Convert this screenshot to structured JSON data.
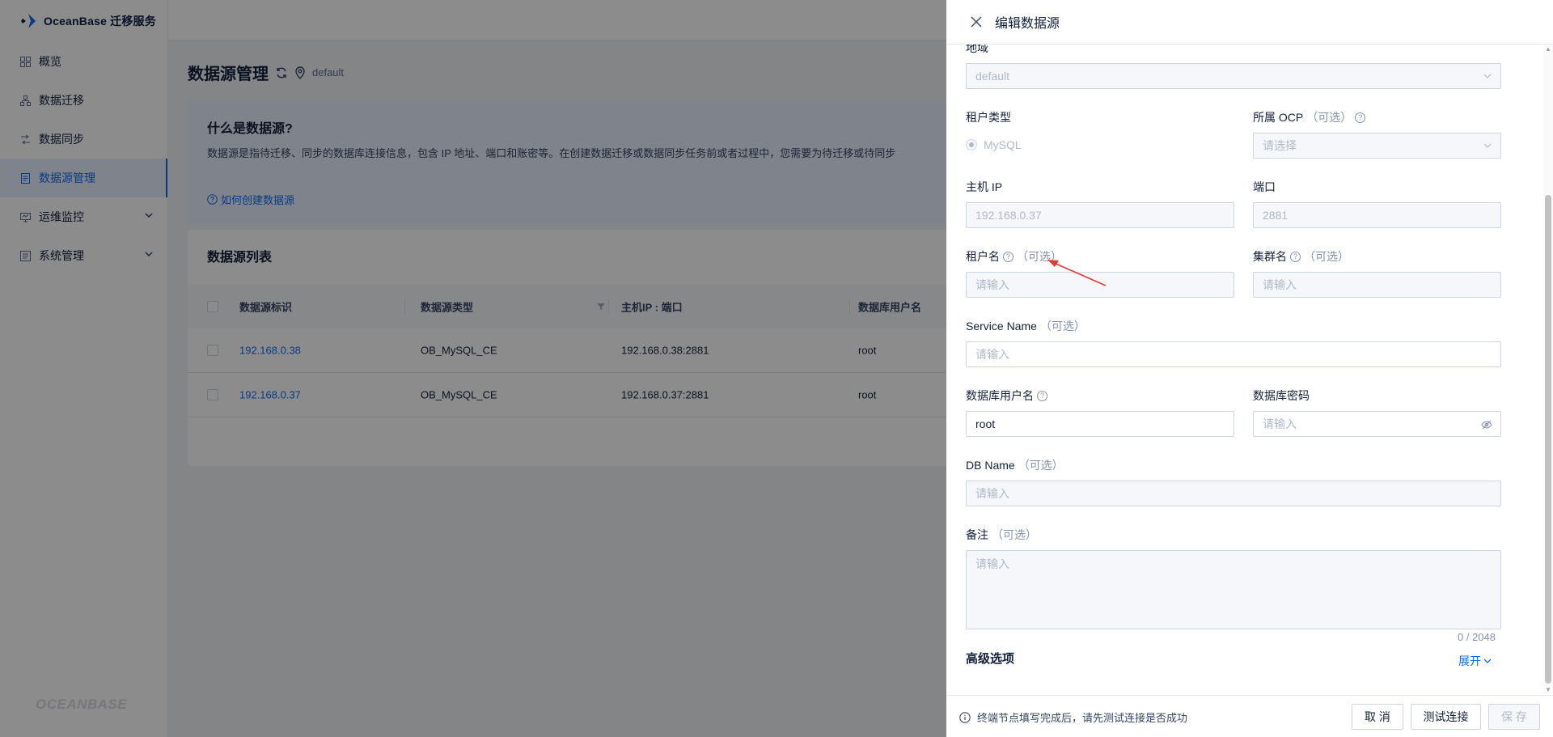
{
  "app": {
    "logo_text": "OceanBase 迁移服务",
    "footer_brand": "OCEANBASE"
  },
  "sidebar": {
    "items": [
      {
        "label": "概览",
        "icon": "grid-icon"
      },
      {
        "label": "数据迁移",
        "icon": "migrate-icon"
      },
      {
        "label": "数据同步",
        "icon": "sync-icon"
      },
      {
        "label": "数据源管理",
        "icon": "datasource-icon",
        "active": true
      },
      {
        "label": "运维监控",
        "icon": "monitor-icon",
        "expandable": true
      },
      {
        "label": "系统管理",
        "icon": "system-icon",
        "expandable": true
      }
    ]
  },
  "page": {
    "title": "数据源管理",
    "region": "default",
    "intro": {
      "title": "什么是数据源?",
      "desc": "数据源是指待迁移、同步的数据库连接信息，包含 IP 地址、端口和账密等。在创建数据迁移或数据同步任务前或者过程中，您需要为待迁移或待同步",
      "link": "如何创建数据源"
    },
    "list": {
      "title": "数据源列表",
      "columns": [
        "数据源标识",
        "数据源类型",
        "主机IP : 端口",
        "数据库用户名"
      ],
      "rows": [
        {
          "id": "192.168.0.38",
          "type": "OB_MySQL_CE",
          "host": "192.168.0.38:2881",
          "user": "root"
        },
        {
          "id": "192.168.0.37",
          "type": "OB_MySQL_CE",
          "host": "192.168.0.37:2881",
          "user": "root"
        }
      ]
    }
  },
  "drawer": {
    "title": "编辑数据源",
    "optional": "（可选）",
    "region_label": "地域",
    "region_value": "default",
    "tenant_type_label": "租户类型",
    "tenant_type_value": "MySQL",
    "ocp_label": "所属 OCP",
    "ocp_placeholder": "请选择",
    "host_label": "主机 IP",
    "host_value": "192.168.0.37",
    "port_label": "端口",
    "port_value": "2881",
    "tenant_label": "租户名",
    "tenant_placeholder": "请输入",
    "cluster_label": "集群名",
    "cluster_placeholder": "请输入",
    "service_label": "Service Name",
    "service_placeholder": "请输入",
    "db_user_label": "数据库用户名",
    "db_user_value": "root",
    "db_pwd_label": "数据库密码",
    "db_pwd_placeholder": "请输入",
    "db_name_label": "DB Name",
    "db_name_placeholder": "请输入",
    "remark_label": "备注",
    "remark_placeholder": "请输入",
    "remark_counter": "0 / 2048",
    "advanced_label": "高级选项",
    "expand_label": "展开",
    "footer_tip": "终端节点填写完成后，请先测试连接是否成功",
    "cancel_label": "取 消",
    "test_label": "测试连接",
    "save_label": "保 存"
  },
  "colors": {
    "primary": "#0d6cf2",
    "annotation_arrow": "#e53935"
  }
}
